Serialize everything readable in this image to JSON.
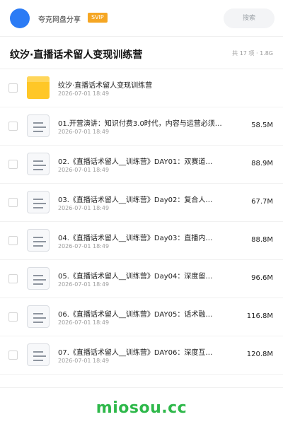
{
  "header": {
    "app_name": "夸克网盘分享",
    "svip_label": "SVIP",
    "search_placeholder": "搜索",
    "colors": {
      "avatar": "#2b7bf5",
      "svip": "#f5a623"
    }
  },
  "page": {
    "title": "纹汐·直播话术留人变现训练营",
    "count_text": "共 17 项",
    "total_size": "1.8G"
  },
  "files": [
    {
      "type": "folder",
      "icon": "folder-icon",
      "name": "纹汐·直播话术留人变现训练营",
      "date": "2026-07-01 18:49",
      "size": ""
    },
    {
      "type": "file",
      "icon": "document-icon",
      "name": "01.开营演讲：知识付费3.0时代，内容与运营必须…",
      "date": "2026-07-01 18:49",
      "size": "58.5M"
    },
    {
      "type": "file",
      "icon": "document-icon",
      "name": "02.《直播话术留人__训练营》DAY01：双赛道…",
      "date": "2026-07-01 18:49",
      "size": "88.9M"
    },
    {
      "type": "file",
      "icon": "document-icon",
      "name": "03.《直播话术留人__训练营》Day02：复合人…",
      "date": "2026-07-01 18:49",
      "size": "67.7M"
    },
    {
      "type": "file",
      "icon": "document-icon",
      "name": "04.《直播话术留人__训练营》Day03：直播内…",
      "date": "2026-07-01 18:49",
      "size": "88.8M"
    },
    {
      "type": "file",
      "icon": "document-icon",
      "name": "05.《直播话术留人__训练营》Day04：深度留…",
      "date": "2026-07-01 18:49",
      "size": "96.6M"
    },
    {
      "type": "file",
      "icon": "document-icon",
      "name": "06.《直播话术留人__训练营》DAY05：话术融…",
      "date": "2026-07-01 18:49",
      "size": "116.8M"
    },
    {
      "type": "file",
      "icon": "document-icon",
      "name": "07.《直播话术留人__训练营》DAY06：深度互…",
      "date": "2026-07-01 18:49",
      "size": "120.8M"
    }
  ],
  "footer": {
    "brand": "miosou.cc",
    "brand_color": "#2eb84a"
  }
}
